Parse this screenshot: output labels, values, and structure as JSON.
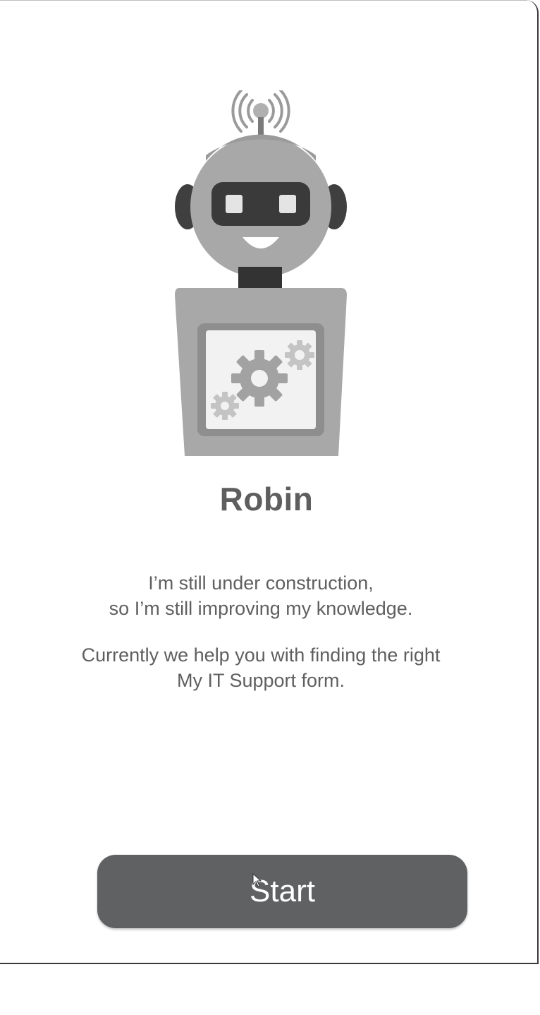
{
  "bot": {
    "name": "Robin",
    "intro_line_1": "I’m still under construction,",
    "intro_line_2": "so I’m still improving my knowledge.",
    "intro_line_3": "Currently we help you with finding the right",
    "intro_line_4": "My IT Support form."
  },
  "actions": {
    "start_label": "Start"
  },
  "colors": {
    "button": "#606163",
    "text": "#5f5f5f",
    "robot_dark": "#3a3a3a",
    "robot_mid": "#9e9e9e",
    "robot_light": "#dcdcdc"
  },
  "icons": {
    "robot": "robot-illustration",
    "cursor": "mouse-pointer-icon"
  }
}
